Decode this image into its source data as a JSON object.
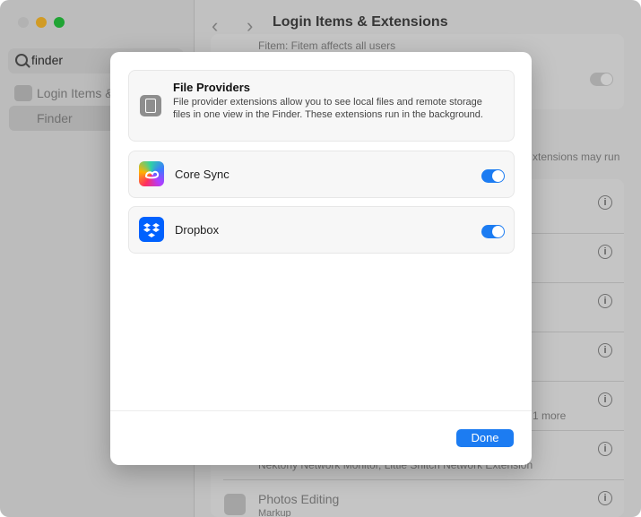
{
  "window": {
    "title": "Login Items & Extensions",
    "traffic_lights": {
      "close_color": "#d9d9d9",
      "minimize_color": "#ffbd2e",
      "zoom_color": "#28c840"
    }
  },
  "sidebar": {
    "search": {
      "value": "finder"
    },
    "items": [
      {
        "label": "Login Items & Extensions"
      },
      {
        "label": "Finder"
      }
    ]
  },
  "background_list": {
    "top_line": "Fitem: Fitem affects all users",
    "may_run_text": "xtensions may run",
    "more_text": "1 more",
    "network_text": "Nektony Network Monitor, Little Snitch Network Extension",
    "photos_editing": {
      "title": "Photos Editing",
      "subtitle": "Markup"
    }
  },
  "modal": {
    "header": {
      "title": "File Providers",
      "description": "File provider extensions allow you to see local files and remote storage files in one view in the Finder. These extensions run in the background."
    },
    "items": [
      {
        "label": "Core Sync",
        "icon": "adobe-creative-cloud-icon",
        "enabled": true
      },
      {
        "label": "Dropbox",
        "icon": "dropbox-icon",
        "enabled": true
      }
    ],
    "done_label": "Done"
  },
  "colors": {
    "accent": "#1c7cf2"
  }
}
